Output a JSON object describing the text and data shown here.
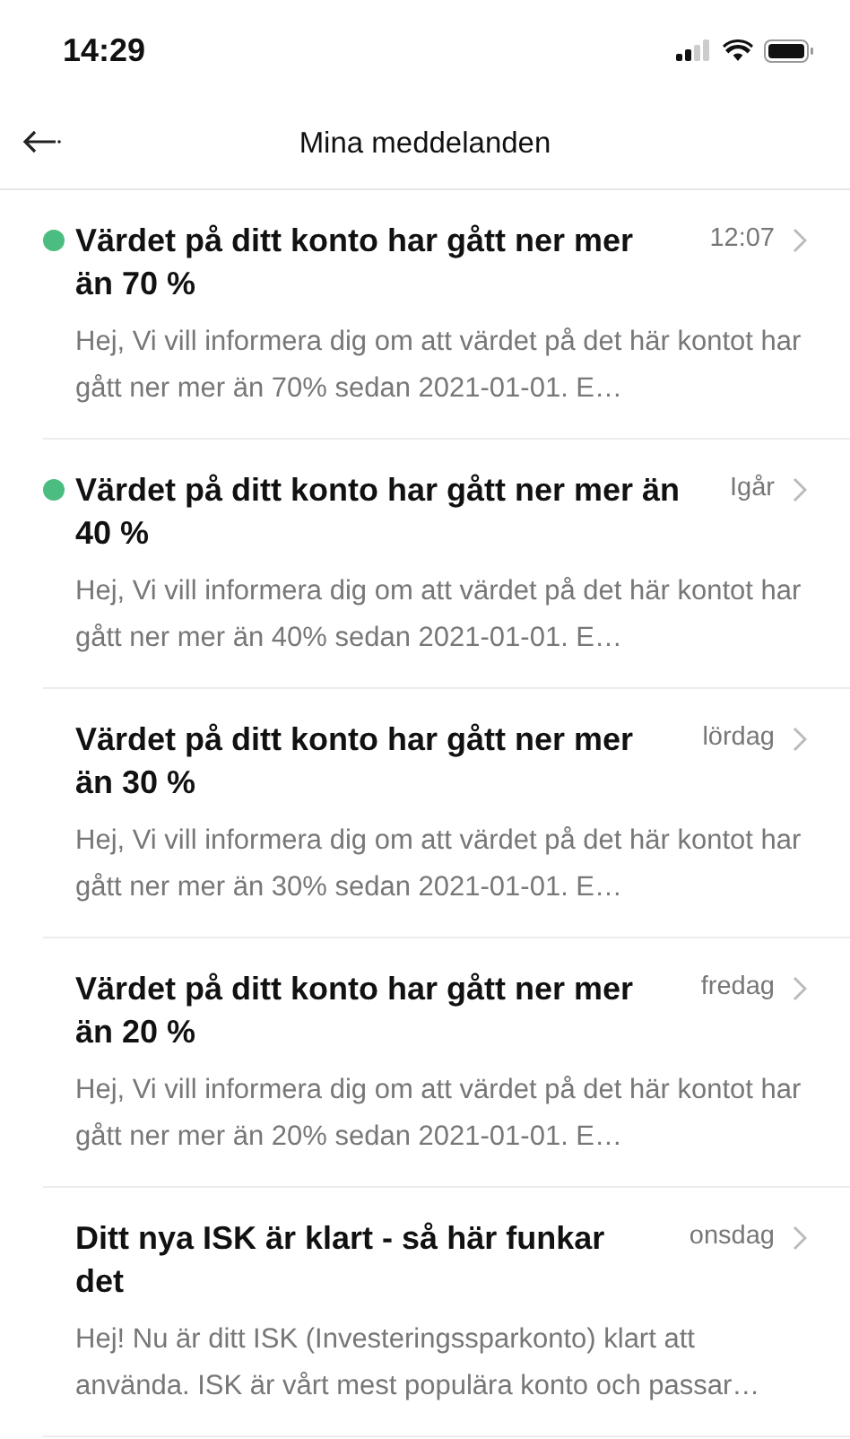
{
  "status_bar": {
    "time": "14:29"
  },
  "header": {
    "title": "Mina meddelanden"
  },
  "messages": [
    {
      "title": "Värdet på ditt konto har gått ner mer än 70 %",
      "time": "12:07",
      "unread": true,
      "preview": "Hej, Vi vill informera dig om att värdet på det här kontot har gått ner mer än 70% sedan 2021-01-01. E…"
    },
    {
      "title": "Värdet på ditt konto har gått ner mer än 40 %",
      "time": "Igår",
      "unread": true,
      "preview": "Hej, Vi vill informera dig om att värdet på det här kontot har gått ner mer än 40% sedan 2021-01-01. E…"
    },
    {
      "title": "Värdet på ditt konto har gått ner mer än 30 %",
      "time": "lördag",
      "unread": false,
      "preview": "Hej, Vi vill informera dig om att värdet på det här kontot har gått ner mer än 30% sedan 2021-01-01. E…"
    },
    {
      "title": "Värdet på ditt konto har gått ner mer än 20 %",
      "time": "fredag",
      "unread": false,
      "preview": "Hej, Vi vill informera dig om att värdet på det här kontot har gått ner mer än 20% sedan 2021-01-01. E…"
    },
    {
      "title": "Ditt nya ISK är klart - så här funkar det",
      "time": "onsdag",
      "unread": false,
      "preview": "Hej! Nu är ditt ISK (Investeringssparkonto) klart att använda. ISK är vårt mest populära konto och passar…"
    }
  ]
}
